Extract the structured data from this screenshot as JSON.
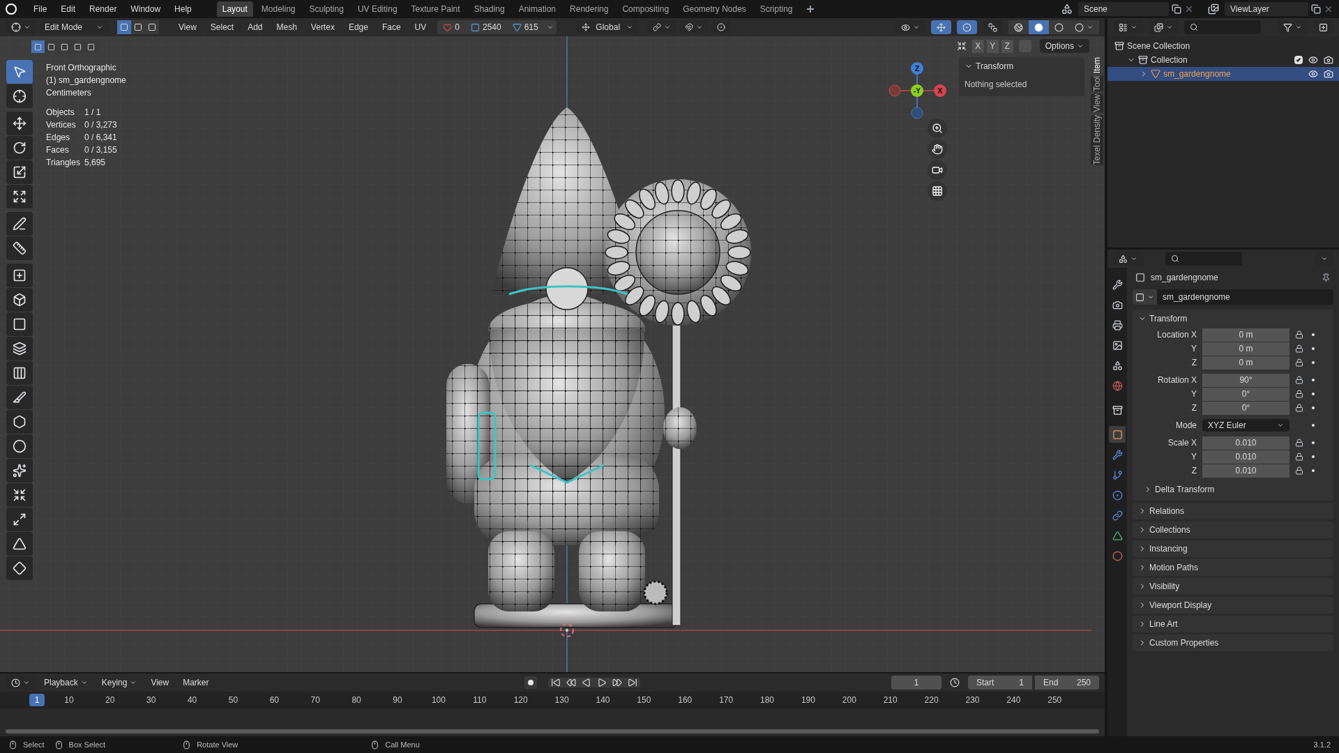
{
  "top_menu": [
    "File",
    "Edit",
    "Render",
    "Window",
    "Help"
  ],
  "workspace_tabs": [
    {
      "label": "Layout",
      "selected": true
    },
    {
      "label": "Modeling",
      "selected": false
    },
    {
      "label": "Sculpting",
      "selected": false
    },
    {
      "label": "UV Editing",
      "selected": false
    },
    {
      "label": "Texture Paint",
      "selected": false
    },
    {
      "label": "Shading",
      "selected": false
    },
    {
      "label": "Animation",
      "selected": false
    },
    {
      "label": "Rendering",
      "selected": false
    },
    {
      "label": "Compositing",
      "selected": false
    },
    {
      "label": "Geometry Nodes",
      "selected": false
    },
    {
      "label": "Scripting",
      "selected": false
    }
  ],
  "scene": {
    "scene": "Scene",
    "view_layer": "ViewLayer"
  },
  "header": {
    "gizmos_on": true,
    "overlays_on": true,
    "shading": [
      {
        "selected": false
      },
      {
        "selected": true
      },
      {
        "selected": false
      },
      {
        "selected": false
      }
    ],
    "mode": "Edit Mode",
    "select_modes": [
      {
        "selected": true
      },
      {
        "selected": false
      },
      {
        "selected": false
      }
    ],
    "menus": [
      "View",
      "Select",
      "Add",
      "Mesh",
      "Vertex",
      "Edge",
      "Face",
      "UV"
    ],
    "stats": [
      "0",
      "2540",
      "615"
    ],
    "orientation": "Global",
    "box_modes": [
      {
        "selected": true
      },
      {
        "selected": false
      },
      {
        "selected": false
      },
      {
        "selected": false
      },
      {
        "selected": false
      }
    ],
    "axes": [
      "X",
      "Y",
      "Z"
    ],
    "options": "Options"
  },
  "viewport": {
    "info": [
      "Front Orthographic",
      "(1) sm_gardengnome",
      "Centimeters"
    ],
    "stats": [
      {
        "label": "Objects",
        "value": "1 / 1"
      },
      {
        "label": "Vertices",
        "value": "0 / 3,273"
      },
      {
        "label": "Edges",
        "value": "0 / 6,341"
      },
      {
        "label": "Faces",
        "value": "0 / 3,155"
      },
      {
        "label": "Triangles",
        "value": "5,695"
      }
    ],
    "gizmo": [
      "Z",
      "-Y",
      "X"
    ],
    "panel": {
      "title": "Transform",
      "message": "Nothing selected"
    },
    "tabs": [
      {
        "label": "Item",
        "selected": true
      },
      {
        "label": "Tool",
        "selected": false
      },
      {
        "label": "View",
        "selected": false
      },
      {
        "label": "Texel Density",
        "selected": false
      }
    ],
    "tools": [
      {
        "selected": true
      },
      {
        "selected": false
      },
      {
        "selected": false
      },
      {
        "selected": false
      },
      {
        "selected": false
      },
      {
        "selected": false
      },
      {
        "selected": false
      },
      {
        "selected": false
      },
      {
        "selected": false
      },
      {
        "selected": false
      },
      {
        "selected": false
      },
      {
        "selected": false
      },
      {
        "selected": false
      },
      {
        "selected": false
      },
      {
        "selected": false
      },
      {
        "selected": false
      },
      {
        "selected": false
      },
      {
        "selected": false
      },
      {
        "selected": false
      },
      {
        "selected": false
      },
      {
        "selected": false
      }
    ]
  },
  "outliner": {
    "items": [
      {
        "label": "Scene Collection",
        "children": [
          {
            "label": "Collection",
            "checked": true,
            "expanded": true,
            "children": [
              {
                "label": "sm_gardengnome",
                "selected": true,
                "expanded": false
              }
            ]
          }
        ]
      }
    ]
  },
  "properties": {
    "tabs": [
      {
        "selected": false
      },
      {
        "selected": false
      },
      {
        "selected": false
      },
      {
        "selected": false
      },
      {
        "selected": false
      },
      {
        "selected": false
      },
      {
        "selected": false
      },
      {
        "selected": true
      },
      {
        "selected": false
      },
      {
        "selected": false
      },
      {
        "selected": false
      },
      {
        "selected": false
      },
      {
        "selected": false
      },
      {
        "selected": false
      }
    ],
    "object": "sm_gardengnome",
    "datablock": "sm_gardengnome",
    "transform": {
      "title": "Transform",
      "expanded": true,
      "groups": [
        {
          "rows": [
            {
              "kind": "number",
              "label": "Location X",
              "value": "0 m"
            },
            {
              "kind": "number",
              "label": "Y",
              "value": "0 m"
            },
            {
              "kind": "number",
              "label": "Z",
              "value": "0 m"
            }
          ]
        },
        {
          "rows": [
            {
              "kind": "number",
              "label": "Rotation X",
              "value": "90°"
            },
            {
              "kind": "number",
              "label": "Y",
              "value": "0°"
            },
            {
              "kind": "number",
              "label": "Z",
              "value": "0°"
            }
          ]
        },
        {
          "rows": [
            {
              "kind": "dropdown",
              "label": "Mode",
              "value": "XYZ Euler"
            }
          ]
        },
        {
          "rows": [
            {
              "kind": "number",
              "label": "Scale X",
              "value": "0.010"
            },
            {
              "kind": "number",
              "label": "Y",
              "value": "0.010"
            },
            {
              "kind": "number",
              "label": "Z",
              "value": "0.010"
            }
          ]
        }
      ],
      "sub_panel": {
        "label": "Delta Transform",
        "expanded": false
      }
    },
    "panels": [
      {
        "label": "Relations",
        "expanded": false
      },
      {
        "label": "Collections",
        "expanded": false
      },
      {
        "label": "Instancing",
        "expanded": false
      },
      {
        "label": "Motion Paths",
        "expanded": false
      },
      {
        "label": "Visibility",
        "expanded": false
      },
      {
        "label": "Viewport Display",
        "expanded": false
      },
      {
        "label": "Line Art",
        "expanded": false
      },
      {
        "label": "Custom Properties",
        "expanded": false
      }
    ]
  },
  "timeline": {
    "menus": [
      {
        "label": "Playback",
        "dropdown": true
      },
      {
        "label": "Keying",
        "dropdown": true
      },
      {
        "label": "View",
        "dropdown": false
      },
      {
        "label": "Marker",
        "dropdown": false
      }
    ],
    "current_frame": "1",
    "start": {
      "label": "Start",
      "value": "1"
    },
    "end": {
      "label": "End",
      "value": "250"
    },
    "frames": [
      {
        "label": "1",
        "selected": true
      },
      {
        "label": "10",
        "selected": false
      },
      {
        "label": "20",
        "selected": false
      },
      {
        "label": "30",
        "selected": false
      },
      {
        "label": "40",
        "selected": false
      },
      {
        "label": "50",
        "selected": false
      },
      {
        "label": "60",
        "selected": false
      },
      {
        "label": "70",
        "selected": false
      },
      {
        "label": "80",
        "selected": false
      },
      {
        "label": "90",
        "selected": false
      },
      {
        "label": "100",
        "selected": false
      },
      {
        "label": "110",
        "selected": false
      },
      {
        "label": "120",
        "selected": false
      },
      {
        "label": "130",
        "selected": false
      },
      {
        "label": "140",
        "selected": false
      },
      {
        "label": "150",
        "selected": false
      },
      {
        "label": "160",
        "selected": false
      },
      {
        "label": "170",
        "selected": false
      },
      {
        "label": "180",
        "selected": false
      },
      {
        "label": "190",
        "selected": false
      },
      {
        "label": "200",
        "selected": false
      },
      {
        "label": "210",
        "selected": false
      },
      {
        "label": "220",
        "selected": false
      },
      {
        "label": "230",
        "selected": false
      },
      {
        "label": "240",
        "selected": false
      },
      {
        "label": "250",
        "selected": false
      }
    ]
  },
  "status_bar": {
    "hints": [
      "Select",
      "Box Select",
      "Rotate View",
      "Call Menu"
    ],
    "version": "3.1.2"
  }
}
